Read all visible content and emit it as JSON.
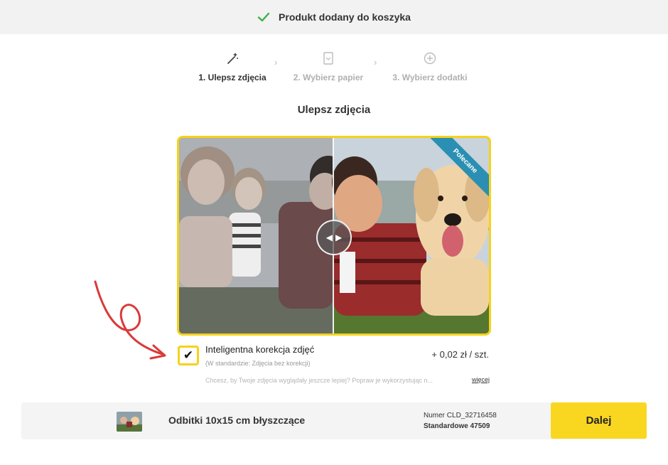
{
  "banner": {
    "message": "Produkt dodany do koszyka",
    "icon": "check-icon",
    "icon_color": "#3cb043"
  },
  "steps": [
    {
      "label": "1. Ulepsz zdjęcia",
      "icon": "magic-wand-icon",
      "active": true
    },
    {
      "label": "2. Wybierz papier",
      "icon": "paper-icon",
      "active": false
    },
    {
      "label": "3. Wybierz dodatki",
      "icon": "add-ons-icon",
      "active": false
    }
  ],
  "step_separator": "›",
  "section_title": "Ulepsz zdjęcia",
  "compare": {
    "ribbon": "Polecane",
    "handle_left": "◀",
    "handle_right": "▶"
  },
  "option": {
    "checked": true,
    "checkmark": "✔",
    "title": "Inteligentna korekcja zdjęć",
    "subtitle": "(W standardzie: Zdjęcia bez korekcji)",
    "price": "+ 0,02 zł / szt.",
    "description": "Chcesz, by Twoje zdjęcia wyglądały jeszcze lepiej? Popraw je wykorzystując n...",
    "more_link": "więcej"
  },
  "bottom": {
    "product_name": "Odbitki 10x15 cm błyszczące",
    "order_number": "Numer CLD_32716458",
    "standard": "Standardowe 47509",
    "next_button": "Dalej"
  },
  "colors": {
    "accent": "#f5d21c",
    "button": "#f9d720",
    "ribbon": "#2a8fb2",
    "arrow": "#d93a3a"
  }
}
